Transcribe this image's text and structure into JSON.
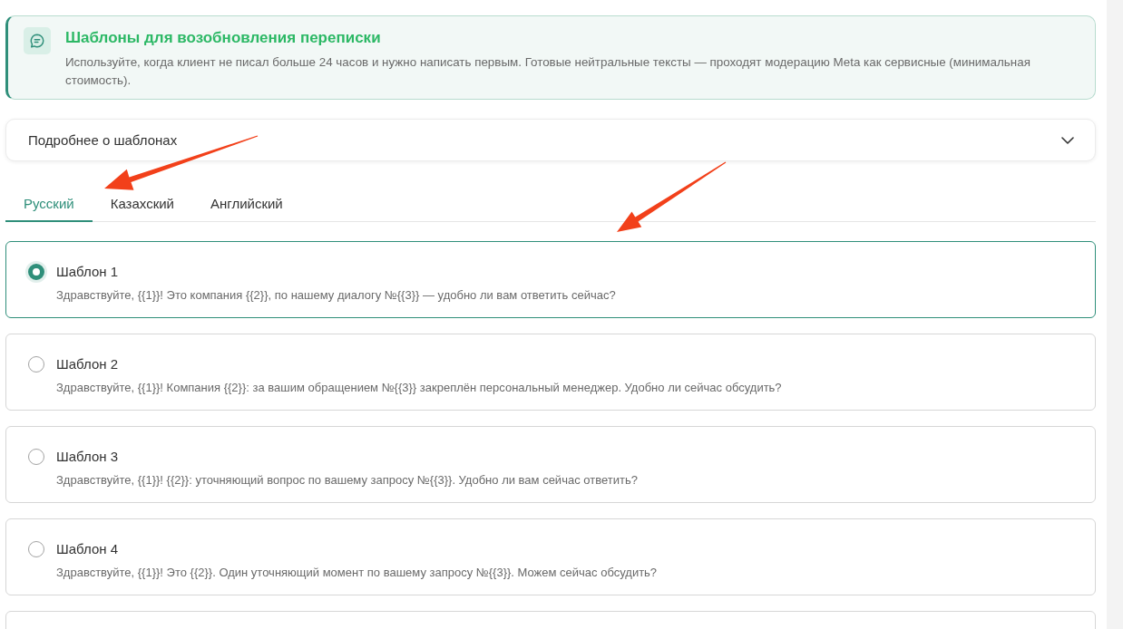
{
  "banner": {
    "title": "Шаблоны для возобновления переписки",
    "description": "Используйте, когда клиент не писал больше 24 часов и нужно написать первым. Готовые нейтральные тексты — проходят модерацию Meta как сервисные (минимальная стоимость)."
  },
  "details": {
    "label": "Подробнее о шаблонах",
    "expanded": false
  },
  "tabs": [
    {
      "label": "Русский",
      "selected": true
    },
    {
      "label": "Казахский",
      "selected": false
    },
    {
      "label": "Английский",
      "selected": false
    }
  ],
  "templates": [
    {
      "title": "Шаблон 1",
      "text": "Здравствуйте, {{1}}! Это компания {{2}}, по нашему диалогу №{{3}} — удобно ли вам ответить сейчас?",
      "selected": true
    },
    {
      "title": "Шаблон 2",
      "text": "Здравствуйте, {{1}}! Компания {{2}}: за вашим обращением №{{3}} закреплён персональный менеджер. Удобно ли сейчас обсудить?",
      "selected": false
    },
    {
      "title": "Шаблон 3",
      "text": "Здравствуйте, {{1}}! {{2}}: уточняющий вопрос по вашему запросу №{{3}}. Удобно ли вам сейчас ответить?",
      "selected": false
    },
    {
      "title": "Шаблон 4",
      "text": "Здравствуйте, {{1}}! Это {{2}}. Один уточняющий момент по вашему запросу №{{3}}. Можем сейчас обсудить?",
      "selected": false
    }
  ]
}
